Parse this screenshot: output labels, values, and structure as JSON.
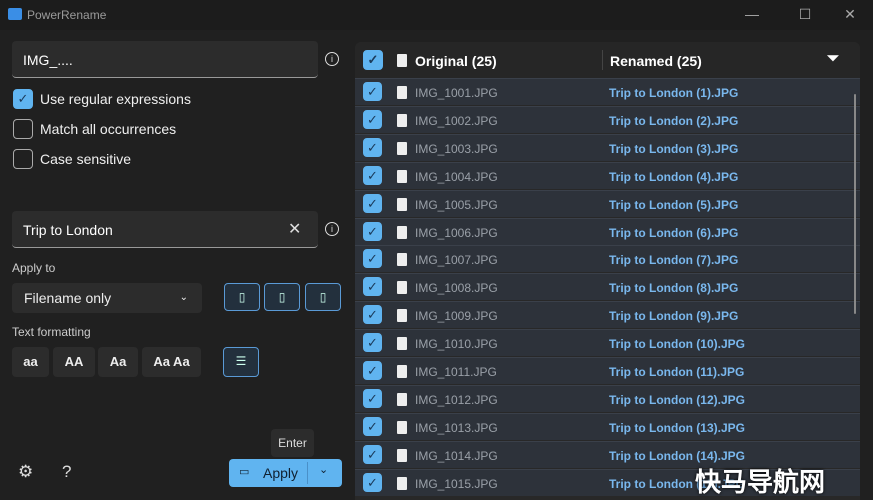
{
  "window": {
    "title": "PowerRename"
  },
  "search": {
    "value": "IMG_...."
  },
  "options": [
    {
      "label": "Use regular expressions",
      "checked": true
    },
    {
      "label": "Match all occurrences",
      "checked": false
    },
    {
      "label": "Case sensitive",
      "checked": false
    }
  ],
  "replace": {
    "value": "Trip to London"
  },
  "apply_to": {
    "label": "Apply to",
    "selected": "Filename only"
  },
  "text_formatting": {
    "label": "Text formatting",
    "buttons": [
      "aa",
      "AA",
      "Aa",
      "Aa Aa"
    ]
  },
  "footer": {
    "help": "?",
    "apply_label": "Apply",
    "tooltip": "Enter"
  },
  "list": {
    "original_header": "Original (25)",
    "renamed_header": "Renamed (25)",
    "rows": [
      [
        "IMG_1001.JPG",
        "Trip to London (1).JPG"
      ],
      [
        "IMG_1002.JPG",
        "Trip to London (2).JPG"
      ],
      [
        "IMG_1003.JPG",
        "Trip to London (3).JPG"
      ],
      [
        "IMG_1004.JPG",
        "Trip to London (4).JPG"
      ],
      [
        "IMG_1005.JPG",
        "Trip to London (5).JPG"
      ],
      [
        "IMG_1006.JPG",
        "Trip to London (6).JPG"
      ],
      [
        "IMG_1007.JPG",
        "Trip to London (7).JPG"
      ],
      [
        "IMG_1008.JPG",
        "Trip to London (8).JPG"
      ],
      [
        "IMG_1009.JPG",
        "Trip to London (9).JPG"
      ],
      [
        "IMG_1010.JPG",
        "Trip to London (10).JPG"
      ],
      [
        "IMG_1011.JPG",
        "Trip to London (11).JPG"
      ],
      [
        "IMG_1012.JPG",
        "Trip to London (12).JPG"
      ],
      [
        "IMG_1013.JPG",
        "Trip to London (13).JPG"
      ],
      [
        "IMG_1014.JPG",
        "Trip to London (14).JPG"
      ],
      [
        "IMG_1015.JPG",
        "Trip to London (15).JPG"
      ]
    ]
  },
  "watermark": "快马导航网",
  "colors": {
    "accent": "#60b4f0"
  }
}
